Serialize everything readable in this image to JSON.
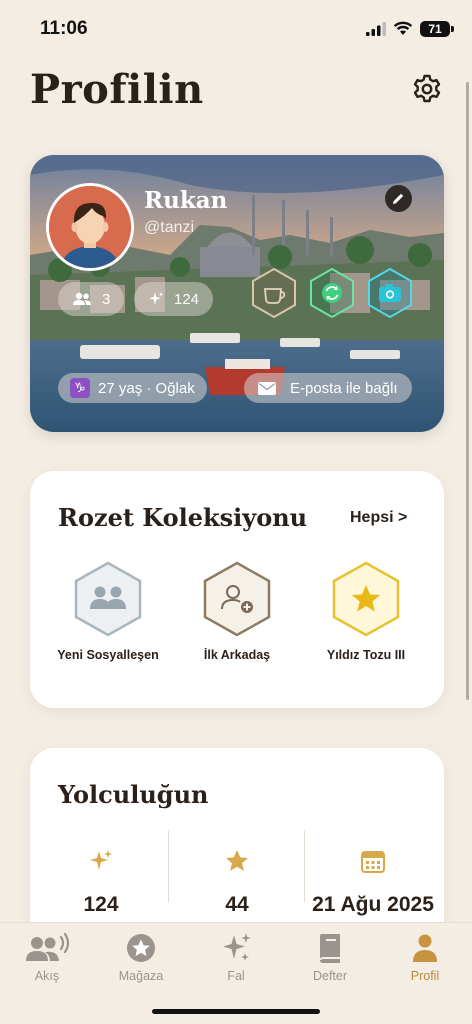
{
  "status": {
    "time": "11:06",
    "battery": "71"
  },
  "page": {
    "title": "Profilin"
  },
  "profile": {
    "name": "Rukan",
    "handle": "@tanzi",
    "friends_count": "3",
    "stars_count": "124",
    "age_sign": "27 yaş · Oğlak",
    "email_status": "E-posta ile bağlı"
  },
  "badges": {
    "title": "Rozet Koleksiyonu",
    "see_all": "Hepsi >",
    "items": [
      {
        "label": "Yeni Sosyalleşen",
        "icon": "people-icon"
      },
      {
        "label": "İlk Arkadaş",
        "icon": "person-add-icon"
      },
      {
        "label": "Yıldız Tozu III",
        "icon": "star-icon"
      }
    ]
  },
  "journey": {
    "title": "Yolculuğun",
    "items": [
      {
        "value": "124",
        "icon": "sparkle-icon"
      },
      {
        "value": "44",
        "icon": "star-icon"
      },
      {
        "value": "21 Ağu 2025",
        "icon": "calendar-icon"
      }
    ]
  },
  "tabs": [
    {
      "label": "Akış",
      "icon": "feed-icon",
      "active": false
    },
    {
      "label": "Mağaza",
      "icon": "store-icon",
      "active": false
    },
    {
      "label": "Fal",
      "icon": "sparkle-icon",
      "active": false
    },
    {
      "label": "Defter",
      "icon": "book-icon",
      "active": false
    },
    {
      "label": "Profil",
      "icon": "profile-icon",
      "active": true
    }
  ],
  "colors": {
    "accent": "#b88a40",
    "background": "#f4ede4",
    "gold": "#d8a94a"
  }
}
